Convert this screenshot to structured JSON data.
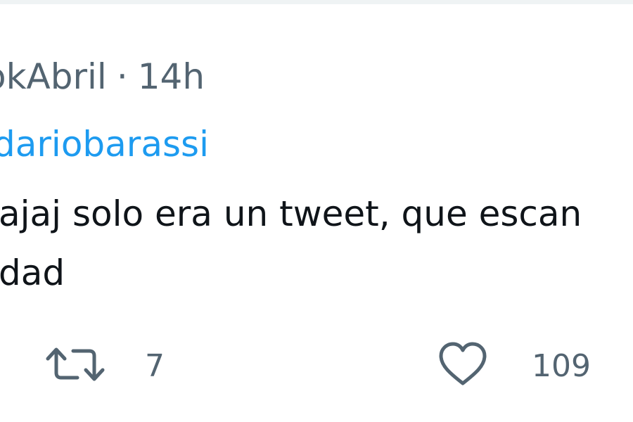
{
  "tweet": {
    "author_fragment": "okAbril",
    "separator": "·",
    "time": "14h",
    "mention": "dariobarassi",
    "text_lines": [
      "ajaj solo era un tweet, que escan",
      "dad"
    ]
  },
  "actions": {
    "retweet": {
      "count": "7",
      "icon": "retweet-icon"
    },
    "like": {
      "count": "109",
      "icon": "heart-icon"
    }
  },
  "colors": {
    "link": "#1d9bf0",
    "secondary_text": "#536471",
    "text": "#0f1419"
  }
}
